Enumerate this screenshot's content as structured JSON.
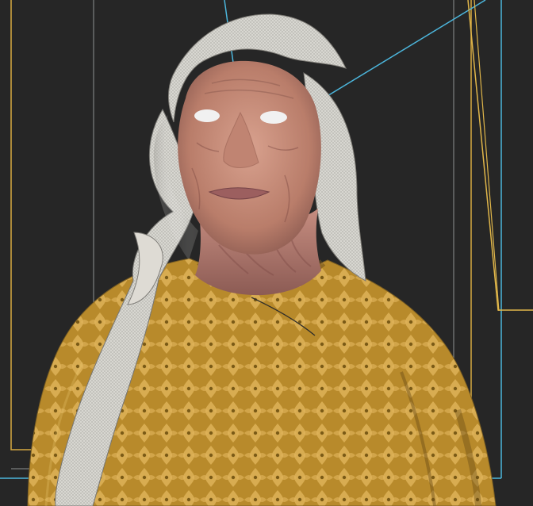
{
  "viewport": {
    "background": "#262626",
    "safe_frame_color": "#e0b64a",
    "camera_line_color": "#5dbbe8",
    "selection_color": "#7f8a8f"
  },
  "model": {
    "dress_color": "#b88a2b",
    "dress_pattern_color": "#e0b45a",
    "scarf_color": "#dcd9d2",
    "skin_color": "#c58d7a",
    "eye_color": "#f1f1f1"
  }
}
